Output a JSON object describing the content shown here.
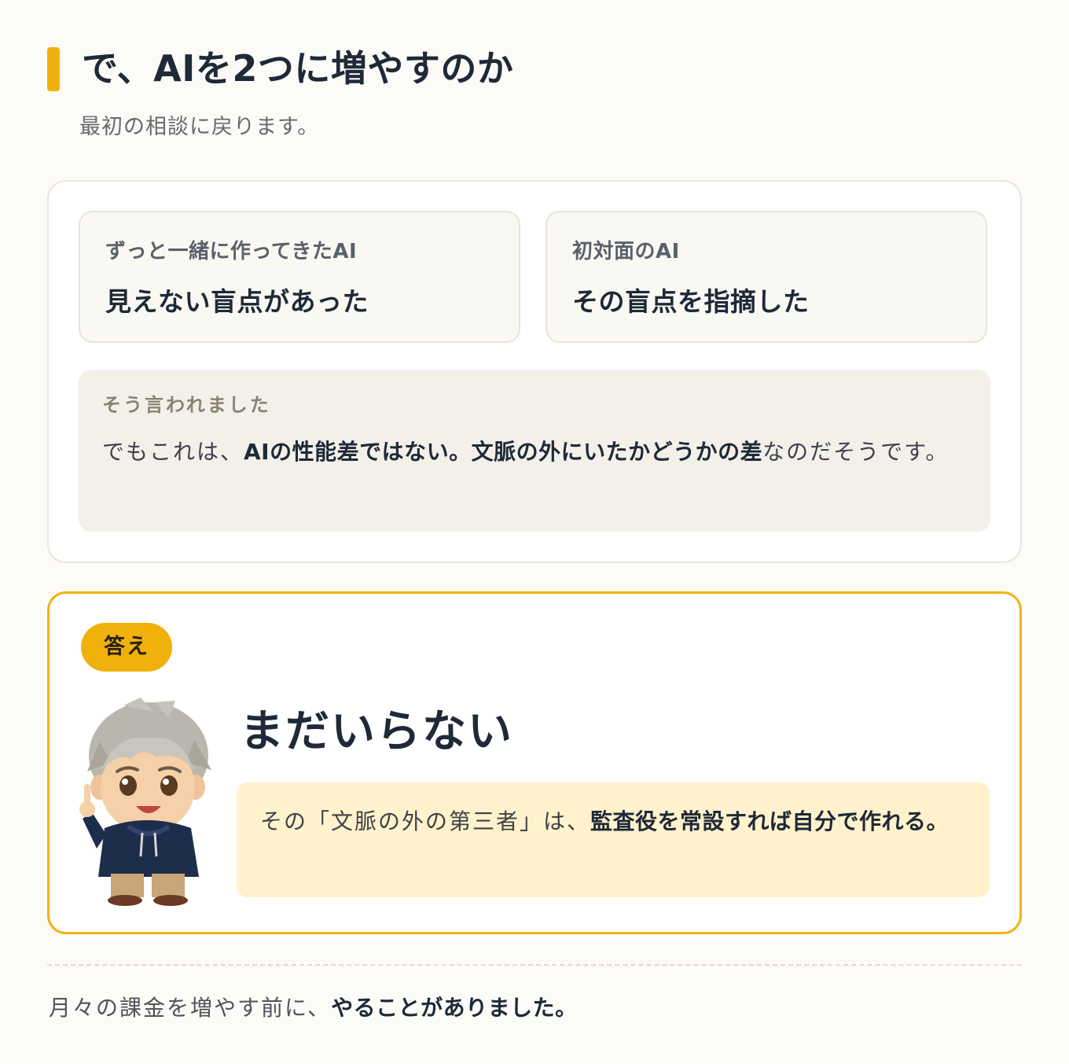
{
  "header": {
    "title": "で、AIを2つに増やすのか",
    "subtitle": "最初の相談に戻ります。"
  },
  "comparison": {
    "left": {
      "label": "ずっと一緒に作ってきたAI",
      "main": "見えない盲点があった"
    },
    "right": {
      "label": "初対面のAI",
      "main": "その盲点を指摘した"
    },
    "note": {
      "label": "そう言われました",
      "text_1": "でもこれは、",
      "bold_1": "AIの性能差ではない。",
      "bold_2": "文脈の外にいたかどうかの差",
      "text_2": "なのだそうです。"
    }
  },
  "answer": {
    "badge": "答え",
    "heading": "まだいらない",
    "text_1": "その「文脈の外の第三者」は、",
    "bold_1": "監査役を常設すれば自分で作れる。"
  },
  "footer": {
    "text_1": "月々の課金を増やす前に、",
    "bold_1": "やることがありました。"
  },
  "colors": {
    "accent": "#f0b10d",
    "background": "#fcfbf7",
    "answer_box": "#fff2cc",
    "note_box": "#f2f0e9"
  }
}
